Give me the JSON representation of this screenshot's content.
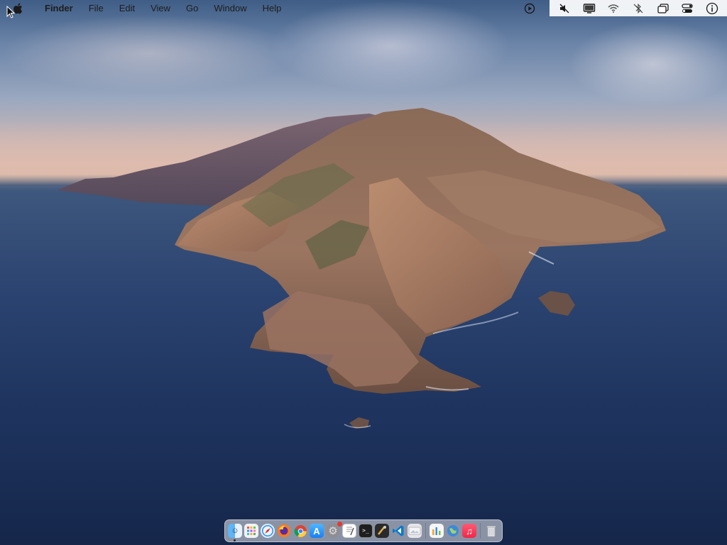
{
  "menubar": {
    "app_name": "Finder",
    "menus": [
      "File",
      "Edit",
      "View",
      "Go",
      "Window",
      "Help"
    ],
    "apple_icon": "apple-logo-icon",
    "status_icons": [
      "screen-record-icon",
      "mute-icon",
      "display-icon",
      "wifi-icon",
      "bluetooth-off-icon",
      "window-icon",
      "control-center-icon",
      "info-icon"
    ]
  },
  "desktop": {
    "wallpaper": "Catalina island over ocean at dusk"
  },
  "dock": {
    "apps": [
      {
        "name": "Finder",
        "icon": "finder-icon",
        "running": true
      },
      {
        "name": "Launchpad",
        "icon": "launchpad-icon"
      },
      {
        "name": "Safari",
        "icon": "safari-icon"
      },
      {
        "name": "Firefox",
        "icon": "firefox-icon"
      },
      {
        "name": "Chrome",
        "icon": "chrome-icon"
      },
      {
        "name": "App Store",
        "icon": "app-store-icon"
      },
      {
        "name": "System Preferences",
        "icon": "system-preferences-icon",
        "badge": true
      },
      {
        "name": "TextEdit",
        "icon": "textedit-icon"
      },
      {
        "name": "Terminal",
        "icon": "terminal-icon"
      },
      {
        "name": "Xcode Instruments",
        "icon": "instruments-icon"
      },
      {
        "name": "Visual Studio Code",
        "icon": "vscode-icon"
      },
      {
        "name": "Preview",
        "icon": "preview-icon"
      },
      {
        "name": "Utility",
        "icon": "utility-icon"
      },
      {
        "name": "Network Utility",
        "icon": "network-icon"
      },
      {
        "name": "Music",
        "icon": "music-icon"
      },
      {
        "name": "Trash",
        "icon": "trash-icon"
      }
    ]
  },
  "colors": {
    "dock_red_badge": "#e23b2e",
    "chrome_red": "#db4437",
    "music_pink": "#fb3b5a"
  }
}
